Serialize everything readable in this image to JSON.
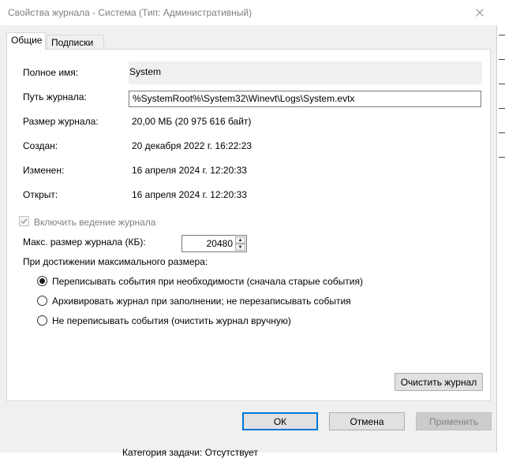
{
  "window": {
    "title": "Свойства журнала - Система (Тип: Административный)"
  },
  "tabs": [
    {
      "label": "Общие",
      "active": true
    },
    {
      "label": "Подписки",
      "active": false
    }
  ],
  "general": {
    "full_name_label": "Полное имя:",
    "full_name_value": "System",
    "path_label": "Путь журнала:",
    "path_value": "%SystemRoot%\\System32\\Winevt\\Logs\\System.evtx",
    "size_label": "Размер журнала:",
    "size_value": "20,00 МБ (20 975 616 байт)",
    "created_label": "Создан:",
    "created_value": "20 декабря 2022 г. 16:22:23",
    "modified_label": "Изменен:",
    "modified_value": "16 апреля 2024 г. 12:20:33",
    "opened_label": "Открыт:",
    "opened_value": "16 апреля 2024 г. 12:20:33",
    "enable_logging_label": "Включить ведение журнала",
    "enable_logging_checked": true,
    "max_size_label": "Макс. размер журнала (КБ):",
    "max_size_value": "20480",
    "on_max_label": "При достижении максимального размера:",
    "options": [
      {
        "label": "Переписывать события при необходимости (сначала старые события)",
        "selected": true
      },
      {
        "label": "Архивировать журнал при заполнении; не перезаписывать события",
        "selected": false
      },
      {
        "label": "Не переписывать события (очистить журнал вручную)",
        "selected": false
      }
    ],
    "clear_log_label": "Очистить журнал"
  },
  "footer": {
    "ok_label": "ОК",
    "cancel_label": "Отмена",
    "apply_label": "Применить"
  },
  "background": {
    "partial_text": "Категория задачи:   Отсутствует"
  },
  "colors": {
    "accent": "#0078d7",
    "panel_bg": "#ffffff",
    "window_bg": "#f0f0f0",
    "disabled_text": "#7f7f7f"
  }
}
